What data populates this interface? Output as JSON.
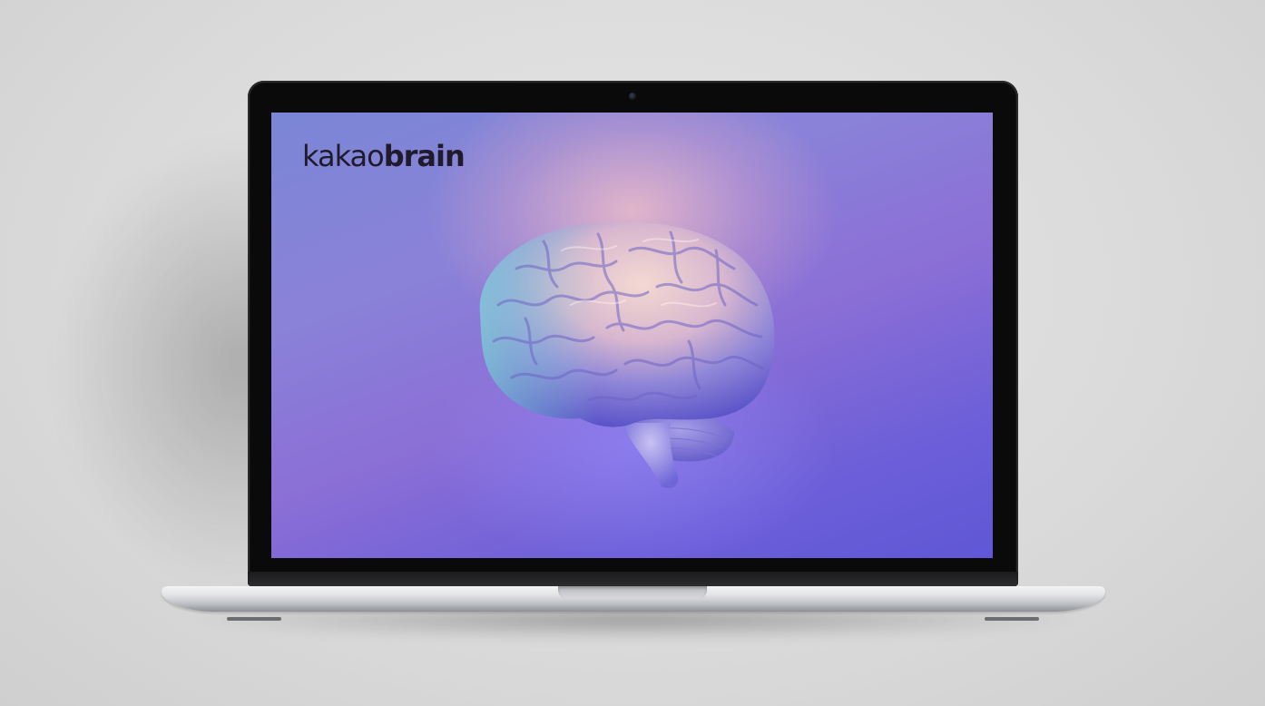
{
  "screen": {
    "logo": {
      "part_light": "kakao",
      "part_bold": "brain"
    },
    "hero_image_icon": "brain-icon"
  },
  "colors": {
    "background": "#dcdcdc",
    "bezel": "#0a0a0b",
    "screen_accent_violet": "#6d5fd8",
    "screen_glow_pink": "#f0bec8",
    "logo_text": "#1f1b2a"
  }
}
